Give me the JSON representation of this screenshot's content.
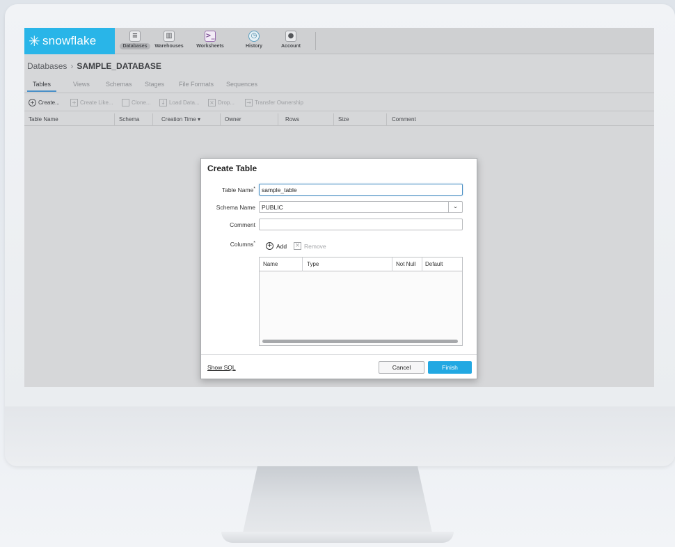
{
  "app": {
    "logo_text": "snowflake",
    "brand_color": "#29b5e8"
  },
  "nav": {
    "items": [
      {
        "label": "Databases",
        "icon": "database-icon",
        "active": true
      },
      {
        "label": "Warehouses",
        "icon": "warehouse-icon",
        "active": false
      },
      {
        "label": "Worksheets",
        "icon": "worksheet-icon",
        "active": false
      },
      {
        "label": "History",
        "icon": "history-icon",
        "active": false
      },
      {
        "label": "Account",
        "icon": "account-icon",
        "active": false
      }
    ]
  },
  "breadcrumb": {
    "root": "Databases",
    "separator": "›",
    "current": "SAMPLE_DATABASE"
  },
  "tabs": [
    "Tables",
    "Views",
    "Schemas",
    "Stages",
    "File Formats",
    "Sequences"
  ],
  "toolbar": {
    "create": "Create...",
    "create_like": "Create Like...",
    "clone": "Clone...",
    "load_data": "Load Data...",
    "drop": "Drop...",
    "transfer": "Transfer Ownership"
  },
  "table": {
    "columns": [
      "Table Name",
      "Schema",
      "Creation Time ▾",
      "Owner",
      "Rows",
      "Size",
      "Comment"
    ]
  },
  "dialog": {
    "title": "Create Table",
    "table_name_label": "Table Name",
    "table_name_value": "sample_table",
    "schema_label": "Schema Name",
    "schema_value": "PUBLIC",
    "comment_label": "Comment",
    "comment_value": "",
    "columns_label": "Columns",
    "required_mark": "*",
    "add_label": "Add",
    "remove_label": "Remove",
    "grid_columns": [
      "Name",
      "Type",
      "Not Null",
      "Default"
    ],
    "show_sql": "Show SQL",
    "cancel": "Cancel",
    "finish": "Finish",
    "accent_color": "#22a8e2"
  }
}
